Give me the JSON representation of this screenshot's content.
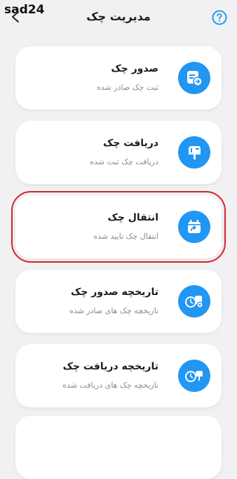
{
  "header": {
    "title": "مدیریت چک",
    "watermark": "sad24",
    "back_icon": "arrow-back-icon",
    "help_icon": "help-circle-icon"
  },
  "colors": {
    "accent": "#2196f3",
    "selected_border": "#d6222b",
    "background": "#f1f1f3",
    "card": "#ffffff"
  },
  "menu": {
    "items": [
      {
        "title": "صدور چک",
        "subtitle": "ثبت چک صادر شده",
        "icon": "issue-cheque-icon"
      },
      {
        "title": "دریافت چک",
        "subtitle": "دریافت چک ثبت شده",
        "icon": "mailbox-icon"
      },
      {
        "title": "انتقال چک",
        "subtitle": "انتقال چک تایید شده",
        "icon": "transfer-calendar-icon",
        "selected": true
      },
      {
        "title": "تاریخچه صدور چک",
        "subtitle": "تاریخچه چک های صادر شده",
        "icon": "issue-history-icon"
      },
      {
        "title": "تاریخچه دریافت چک",
        "subtitle": "تاریخچه چک های دریافت شده",
        "icon": "receive-history-icon"
      }
    ]
  }
}
